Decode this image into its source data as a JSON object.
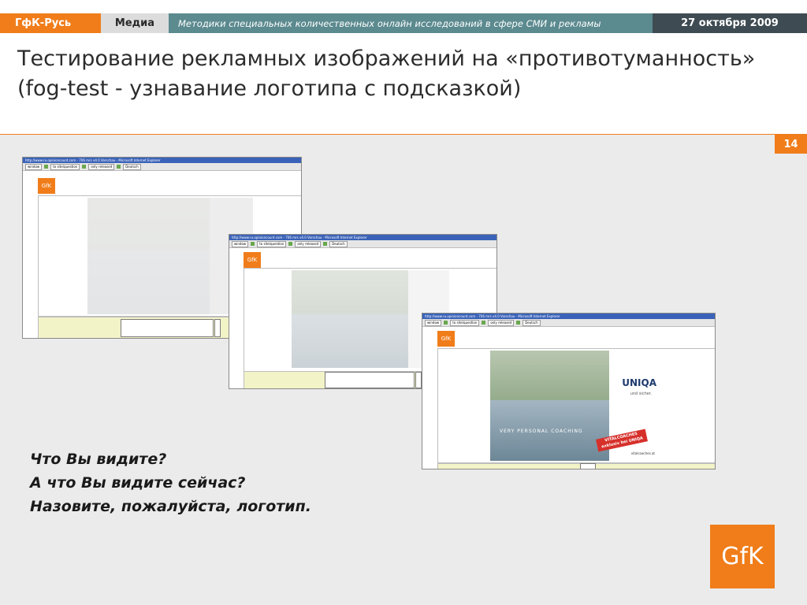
{
  "header": {
    "brand": "ГфК-Русь",
    "section": "Медиа",
    "description": "Методики специальных количественных онлайн исследований в сфере СМИ и рекламы",
    "date": "27 октября 2009"
  },
  "title": "Тестирование рекламных изображений на «противотуманность» (fog-test - узнавание логотипа с подсказкой)",
  "page_number": "14",
  "questions": [
    "Что Вы видите?",
    "А что Вы видите сейчас?",
    "Назовите, пожалуйста, логотип."
  ],
  "logo_text": "GfK",
  "screens": {
    "window_title": "http://www.ru.opinioncount.com - 706 mrs v4.0 Vorschau - Microsoft Internet Explorer",
    "toolbar": [
      "window",
      "to site/question",
      "only released",
      "Deutsch"
    ],
    "logo": "GfK",
    "ad": {
      "brand": "UNIQA",
      "brand_sub": "und sicher.",
      "slogan": "VERY PERSONAL COACHING",
      "badge_line1": "VITALCOACHES",
      "badge_line2": "exklusiv bei UNIQA",
      "url": "vitalcoaches.at"
    }
  },
  "colors": {
    "accent": "#f07d1a",
    "teal": "#5b8a8f",
    "dark": "#3e4b52"
  }
}
